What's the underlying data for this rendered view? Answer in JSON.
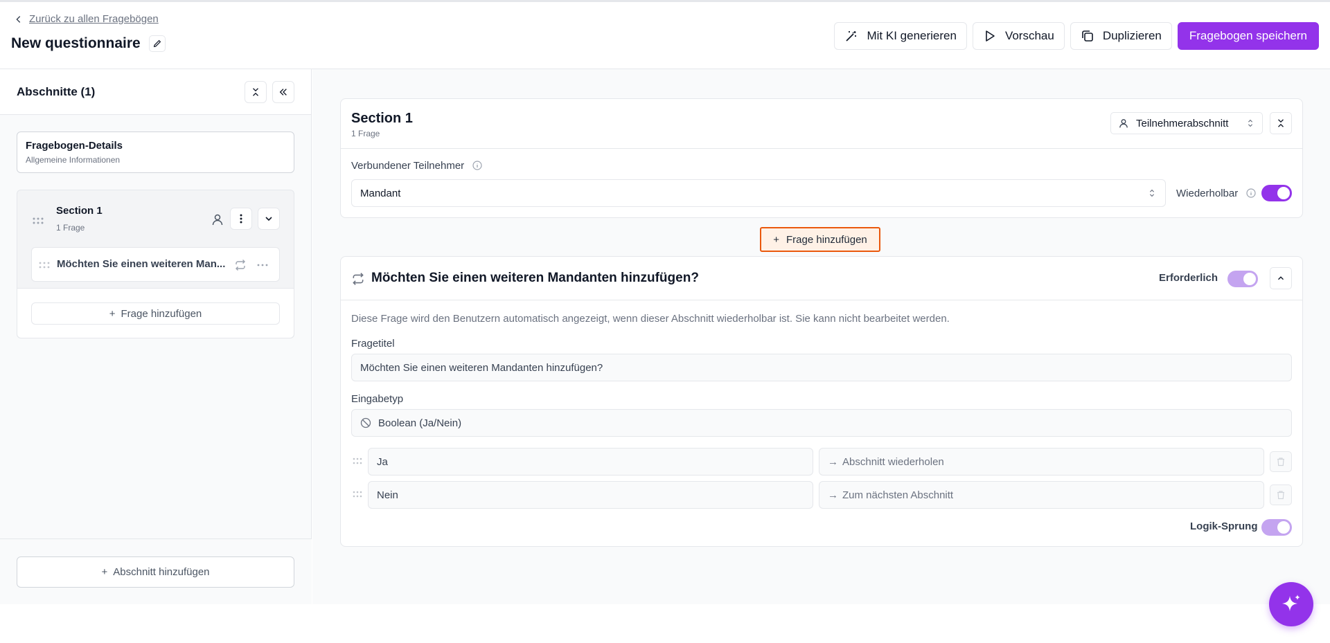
{
  "header": {
    "back_link": "Zurück zu allen Fragebögen",
    "title": "New questionnaire",
    "buttons": {
      "ai": "Mit KI generieren",
      "preview": "Vorschau",
      "duplicate": "Duplizieren",
      "save": "Fragebogen speichern"
    }
  },
  "sidebar": {
    "heading": "Abschnitte (1)",
    "details": {
      "title": "Fragebogen-Details",
      "subtitle": "Allgemeine Informationen"
    },
    "section": {
      "title": "Section 1",
      "count": "1 Frage",
      "question": "Möchten Sie einen weiteren Man...",
      "add_question": "Frage hinzufügen"
    },
    "add_section": "Abschnitt hinzufügen"
  },
  "main": {
    "section": {
      "title": "Section 1",
      "count": "1 Frage",
      "type_select": "Teilnehmerabschnitt",
      "participant_label": "Verbundener Teilnehmer",
      "participant_value": "Mandant",
      "repeatable_label": "Wiederholbar",
      "repeatable": true
    },
    "add_question": "Frage hinzufügen",
    "question": {
      "title": "Möchten Sie einen weiteren Mandanten hinzufügen?",
      "required_label": "Erforderlich",
      "required": true,
      "note": "Diese Frage wird den Benutzern automatisch angezeigt, wenn dieser Abschnitt wiederholbar ist. Sie kann nicht bearbeitet werden.",
      "title_label": "Fragetitel",
      "title_value": "Möchten Sie einen weiteren Mandanten hinzufügen?",
      "input_type_label": "Eingabetyp",
      "input_type_value": "Boolean (Ja/Nein)",
      "options": [
        {
          "label": "Ja",
          "jump": "Abschnitt wiederholen"
        },
        {
          "label": "Nein",
          "jump": "Zum nächsten Abschnitt"
        }
      ],
      "logic_label": "Logik-Sprung",
      "logic": true
    }
  },
  "colors": {
    "accent": "#9333ea",
    "highlight_border": "#ea580c"
  }
}
